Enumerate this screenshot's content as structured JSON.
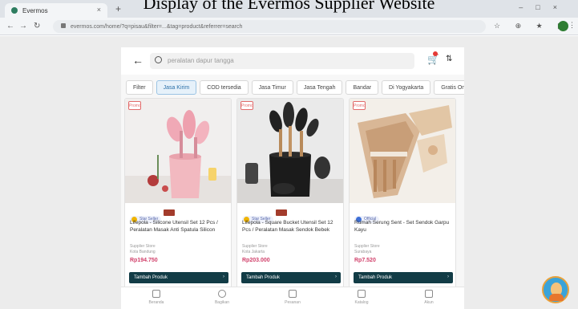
{
  "caption": "Display of the Evermos Supplier Website",
  "browser": {
    "tab_title": "Evermos",
    "new_tab": "+",
    "close": "×",
    "url": "evermos.com/home/?q=pisau&filter=...&tag=product&referrer=search"
  },
  "search": {
    "back_icon": "arrow-left-icon",
    "placeholder": "peralatan dapur tangga",
    "cart_icon": "cart-icon",
    "sort_icon": "sort-icon"
  },
  "filters": [
    {
      "label": "Filter",
      "active": false
    },
    {
      "label": "Jasa Kirim",
      "active": true
    },
    {
      "label": "COD tersedia",
      "active": false
    },
    {
      "label": "Jasa Timur",
      "active": false
    },
    {
      "label": "Jasa Tengah",
      "active": false
    },
    {
      "label": "Bandar",
      "active": false
    },
    {
      "label": "Di Yogyakarta",
      "active": false
    },
    {
      "label": "Gratis Ongkir",
      "active": false
    }
  ],
  "products": [
    {
      "tag": "Promo",
      "badge": "Star Seller",
      "name": "Lifepola - Silicone Utensil Set 12 Pcs / Peralatan Masak Anti Spatula Silicon",
      "seller": "Supplier Store",
      "location": "Kota Bandung",
      "price": "Rp194.750",
      "button": "Tambah Produk"
    },
    {
      "tag": "Promo",
      "badge": "Star Seller",
      "name": "Lifepola - Square Bucket Utensil Set 12 Pcs / Peralatan Masak Sendok Bebek",
      "seller": "Supplier Store",
      "location": "Kota Jakarta",
      "price": "Rp203.000",
      "button": "Tambah Produk"
    },
    {
      "tag": "Promo",
      "badge": "Official",
      "name": "Rumah Serung Sent - Set Sendok Garpu Kayu",
      "seller": "Supplier Store",
      "location": "Surabaya",
      "price": "Rp7.520",
      "button": "Tambah Produk"
    }
  ],
  "bottom_nav": [
    {
      "label": "Beranda",
      "icon": "home-icon"
    },
    {
      "label": "Bagikan",
      "icon": "share-icon"
    },
    {
      "label": "Pesanan",
      "icon": "orders-icon"
    },
    {
      "label": "Katalog",
      "icon": "catalog-icon"
    },
    {
      "label": "Akun",
      "icon": "account-icon"
    }
  ],
  "colors": {
    "primary_button": "#123c46",
    "price": "#d1416b",
    "active_chip": "#2a6fa8"
  }
}
